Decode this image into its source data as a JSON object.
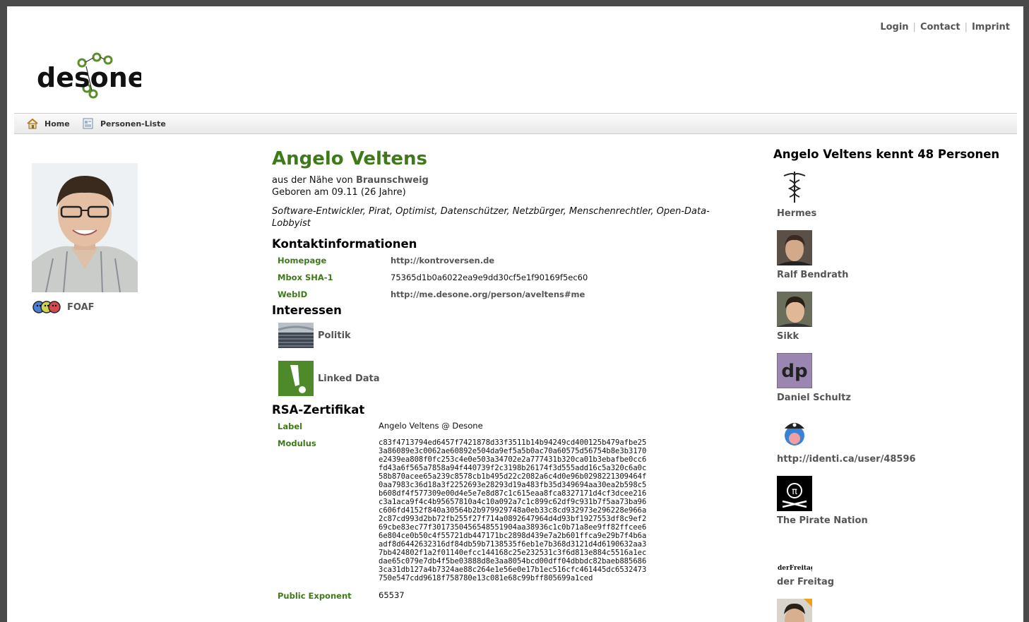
{
  "top_links": [
    "Login",
    "Contact",
    "Imprint"
  ],
  "logo_text": "desone",
  "nav": {
    "home": "Home",
    "people_list": "Personen-Liste"
  },
  "profile": {
    "name": "Angelo Veltens",
    "near_prefix": "aus der Nähe von",
    "city": "Braunschweig",
    "born": "Geboren am 09.11 (26 Jahre)",
    "tags": "Software-Entwickler, Pirat, Optimist, Datenschützer, Netzbürger, Menschenrechtler, Open-Data-Lobbyist",
    "foaf_label": "FOAF"
  },
  "contact": {
    "heading": "Kontaktinformationen",
    "rows": [
      {
        "label": "Homepage",
        "value": "http://kontroversen.de"
      },
      {
        "label": "Mbox SHA-1",
        "value": "75365d1b0a6022ea9e9dd30cf5e1f90169f5ec60"
      },
      {
        "label": "WebID",
        "value": "http://me.desone.org/person/aveltens#me"
      }
    ]
  },
  "interests": {
    "heading": "Interessen",
    "items": [
      "Politik",
      "Linked Data"
    ]
  },
  "rsa": {
    "heading": "RSA-Zertifikat",
    "label_key": "Label",
    "label_value": "Angelo Veltens @ Desone",
    "modulus_key": "Modulus",
    "modulus_value": "c83f4713794ed6457f7421878d33f3511b14b94249cd400125b479afbe25\n3a86089e3c0062ae60892e504da9ef5a5b0ac70a60575d56754b8e3b3170\ne2439ea808f0fc253c4e0e503a34702e2a777431b320ca01b3ebafbe0cc6\nfd43a6f565a7858a94f440739f2c3198b26174f3d555add16c5a320c6a0c\n58b870acee65a239c8578cb1b495d22c2082a6c4d0e96b0298221309464f\n0aa7983c36d18a3f2252693e28293d19a483fb35d349694aa30ea2b598c5\nb608df4f577309e00d4e5e7e8d87c1c615eaa8fca8327171d4cf3dcee216\nc3a1aca9f4c4b95657810a4c10a092a7c1c899c62df9c931b7f5aa73ba96\nc606fd4152f840a30564b2b979929748a0eb33c8cd932973e296228e966a\n2c87cd993d2bb72fb255f27f714a0892647964d4d93bf1927553df8c9ef2\n69cbe83ec77f3017350456548551904aa38936c1c0b71a8ee9ff82ffcee6\n6e804ce0b50c4f55721db447171bc2898d439e7a2b601ffca9e29b7f4b6a\nadf8d6442632316df84db59b7138535f6eb1e7b368d3121d4d6190632aa3\n7bb424802f1a2f01140efcc144168c25e232531c3f6d813e884c5516a1ec\ndae65c079e7db4f5be03888d8e3aa8054bcd00dff04dbbdc82baeb885686\n3ca31db127a4b7324ae88c264e1e56e0e17b1ec516cfc461445dc6532473\n750e547cdd9618f758780e13c081e68c99bff805699a1ced",
    "exponent_key": "Public Exponent",
    "exponent_value": "65537"
  },
  "friends": {
    "heading": "Angelo Veltens kennt 48 Personen",
    "items": [
      {
        "name": "Hermes",
        "icon": "caduceus-icon"
      },
      {
        "name": "Ralf Bendrath",
        "icon": "person-photo"
      },
      {
        "name": "Sikk",
        "icon": "person-photo"
      },
      {
        "name": "Daniel Schultz",
        "icon": "dp-logo",
        "logo_text": "dp"
      },
      {
        "name": "http://identi.ca/user/48596",
        "icon": "pirate-bird-icon"
      },
      {
        "name": "The Pirate Nation",
        "icon": "pirate-flag-icon"
      },
      {
        "name": "der Freitag",
        "icon": "freitag-logo",
        "logo_text": "derFreitag"
      },
      {
        "name": "",
        "icon": "person-photo"
      }
    ]
  }
}
